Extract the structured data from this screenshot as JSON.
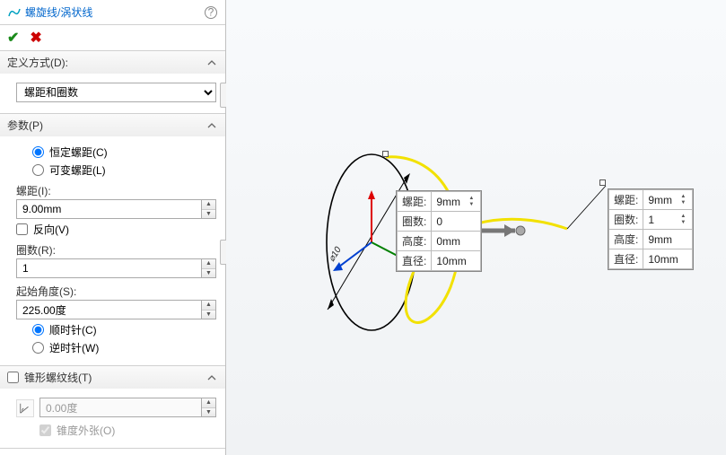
{
  "header": {
    "title": "螺旋线/涡状线"
  },
  "define": {
    "label": "定义方式(D):",
    "selected": "螺距和圈数"
  },
  "params": {
    "label": "参数(P)",
    "pitch_mode": {
      "constant": "恒定螺距(C)",
      "variable": "可变螺距(L)"
    },
    "pitch": {
      "label": "螺距(I):",
      "value": "9.00mm"
    },
    "reverse": {
      "label": "反向(V)"
    },
    "revolutions": {
      "label": "圈数(R):",
      "value": "1"
    },
    "start_angle": {
      "label": "起始角度(S):",
      "value": "225.00度"
    },
    "direction": {
      "cw": "顺时针(C)",
      "ccw": "逆时针(W)"
    }
  },
  "taper": {
    "label": "锥形螺纹线(T)",
    "value": "0.00度",
    "outward": "锥度外张(O)"
  },
  "callout1": {
    "pitch": {
      "label": "螺距:",
      "value": "9mm"
    },
    "rev": {
      "label": "圈数:",
      "value": "0"
    },
    "height": {
      "label": "高度:",
      "value": "0mm"
    },
    "dia": {
      "label": "直径:",
      "value": "10mm"
    }
  },
  "callout2": {
    "pitch": {
      "label": "螺距:",
      "value": "9mm"
    },
    "rev": {
      "label": "圈数:",
      "value": "1"
    },
    "height": {
      "label": "高度:",
      "value": "9mm"
    },
    "dia": {
      "label": "直径:",
      "value": "10mm"
    }
  },
  "dia_dim": "⌀10"
}
